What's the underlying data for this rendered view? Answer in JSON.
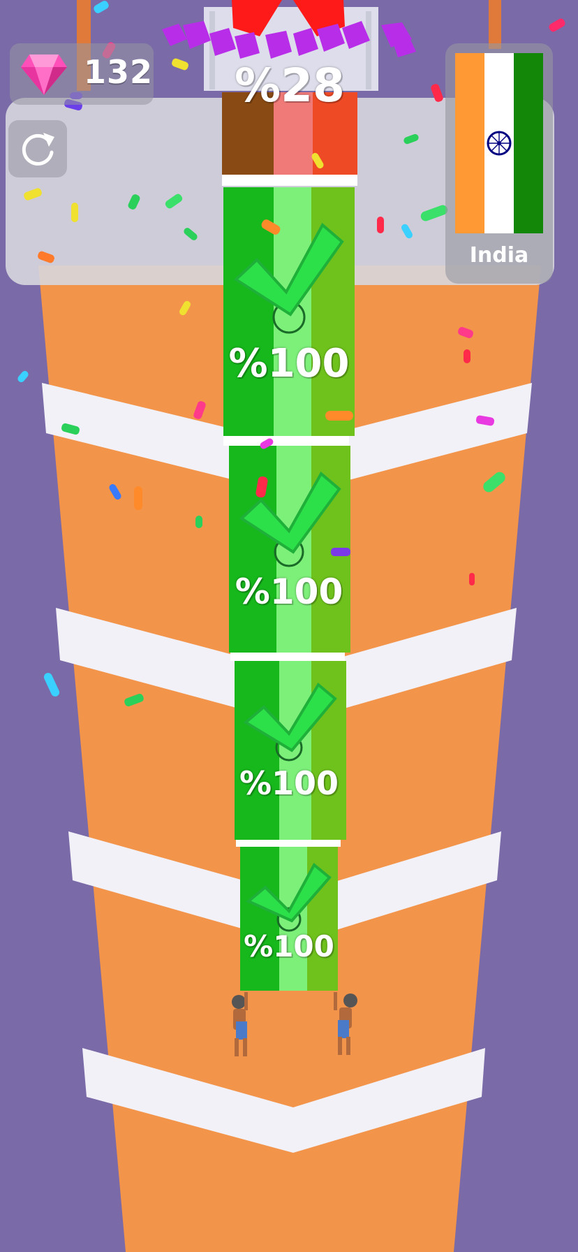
{
  "hud": {
    "gem_count": "132",
    "gem_icon": "pink-diamond-icon",
    "restart_icon": "restart-icon"
  },
  "progress": {
    "label": "%28",
    "value_percent": 28
  },
  "country": {
    "name": "India",
    "flag_colors": [
      "#ff9933",
      "#ffffff",
      "#138808"
    ],
    "chakra_color": "#000080"
  },
  "tiles": [
    {
      "label": "%100",
      "status": "complete"
    },
    {
      "label": "%100",
      "status": "complete"
    },
    {
      "label": "%100",
      "status": "complete"
    },
    {
      "label": "%100",
      "status": "complete"
    }
  ],
  "colors": {
    "background": "#7a6aa8",
    "road_orange": "#f2944a",
    "road_white": "#f3f1f8",
    "tile_dark_green": "#16b81c",
    "tile_light_green": "#7df07a",
    "tile_olive_green": "#6fc21c",
    "check_green": "#2ce04a",
    "top_tile_brown": "#8a4a14",
    "top_tile_pink": "#f07a78",
    "top_tile_red": "#ee4a26"
  }
}
